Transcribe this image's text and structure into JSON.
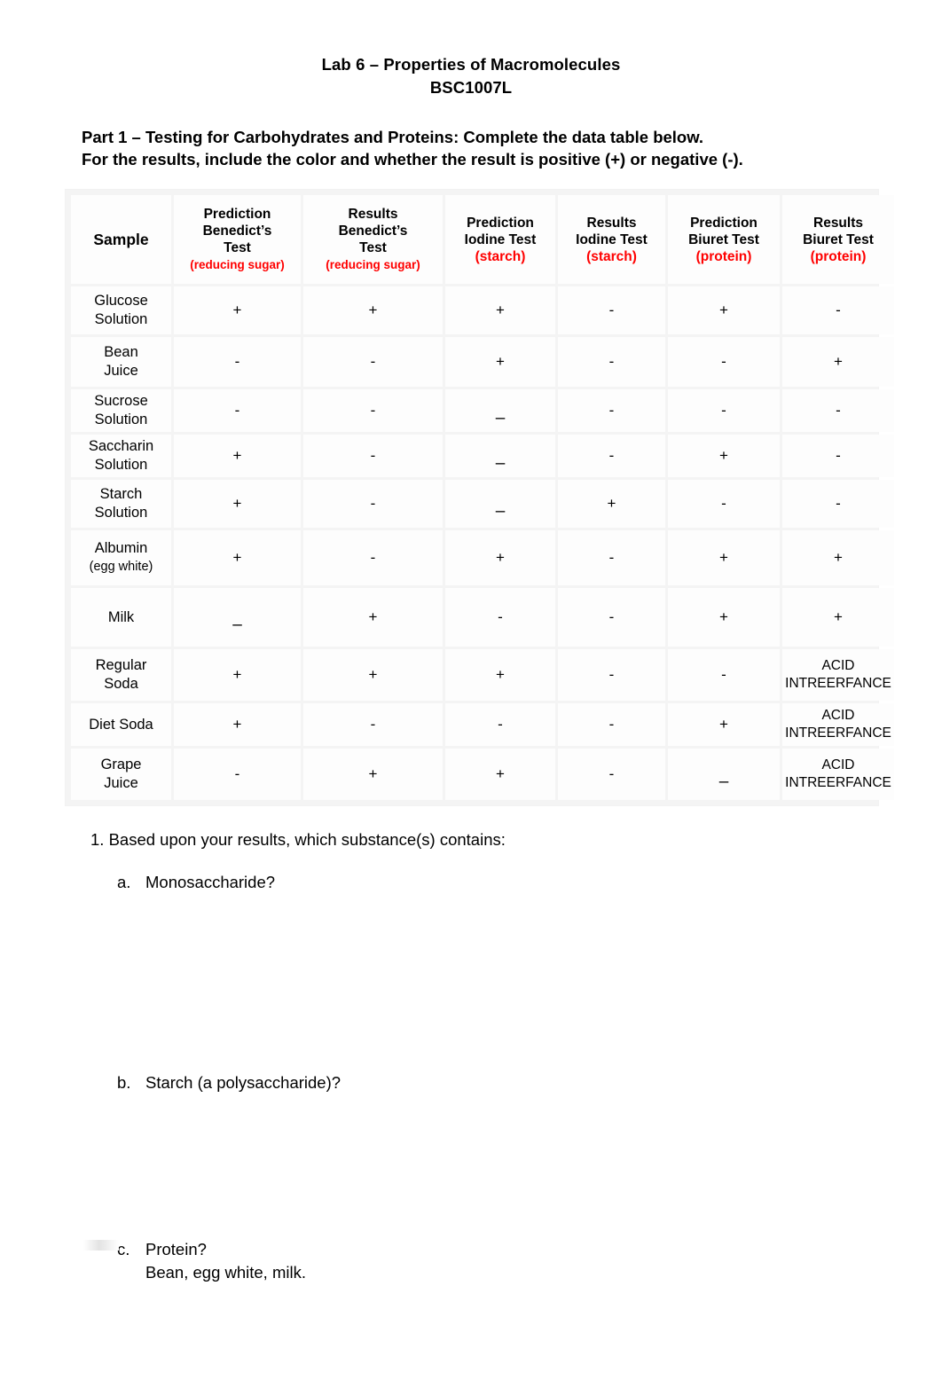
{
  "document": {
    "title": "Lab 6 – Properties of Macromolecules",
    "subtitle": "BSC1007L",
    "intro_line1": "Part 1 – Testing for Carbohydrates and Proteins: Complete the data table below.",
    "intro_line2": "For the results, include the color and whether the result is positive (+) or negative (-)."
  },
  "colors": {
    "red_accent": "#ff0000",
    "text": "#000000",
    "cell_background": "#fdfdfd",
    "table_gap": "#f4f4f4"
  },
  "table": {
    "headers": [
      {
        "main": "Sample",
        "red": ""
      },
      {
        "main": "Prediction Benedict’s Test",
        "red": "(reducing sugar)"
      },
      {
        "main": "Results Benedict’s Test",
        "red": "(reducing sugar)"
      },
      {
        "main": "Prediction Iodine Test",
        "red": "(starch)"
      },
      {
        "main": "Results Iodine Test",
        "red": "(starch)"
      },
      {
        "main": "Prediction Biuret Test",
        "red": "(protein)"
      },
      {
        "main": "Results Biuret Test",
        "red": "(protein)"
      }
    ],
    "header_lines": [
      {
        "lines": [
          "Sample"
        ],
        "red": ""
      },
      {
        "lines": [
          "Prediction",
          "Benedict’s",
          "Test"
        ],
        "red": "(reducing sugar)"
      },
      {
        "lines": [
          "Results",
          "Benedict’s",
          "Test"
        ],
        "red": "(reducing sugar)"
      },
      {
        "lines": [
          "Prediction",
          "Iodine Test"
        ],
        "red": "(starch)"
      },
      {
        "lines": [
          "Results",
          "Iodine Test"
        ],
        "red": "(starch)"
      },
      {
        "lines": [
          "Prediction",
          "Biuret Test"
        ],
        "red": "(protein)"
      },
      {
        "lines": [
          "Results",
          "Biuret Test"
        ],
        "red": "(protein)"
      }
    ],
    "rows": [
      {
        "sample": "Glucose Solution",
        "sample_lines": [
          "Glucose",
          "Solution"
        ],
        "sample_sub": "",
        "pred_benedict": "+",
        "res_benedict": "+",
        "pred_iodine": "+",
        "res_iodine": "-",
        "pred_biuret": "+",
        "res_biuret": "-"
      },
      {
        "sample": "Bean Juice",
        "sample_lines": [
          "Bean",
          "Juice"
        ],
        "sample_sub": "",
        "pred_benedict": "-",
        "res_benedict": "-",
        "pred_iodine": "+",
        "res_iodine": "-",
        "pred_biuret": "-",
        "res_biuret": "+"
      },
      {
        "sample": "Sucrose Solution",
        "sample_lines": [
          "Sucrose",
          "Solution"
        ],
        "sample_sub": "",
        "pred_benedict": "-",
        "res_benedict": "-",
        "pred_iodine": "–",
        "res_iodine": "-",
        "pred_biuret": "-",
        "res_biuret": "-"
      },
      {
        "sample": "Saccharin Solution",
        "sample_lines": [
          "Saccharin",
          "Solution"
        ],
        "sample_sub": "",
        "pred_benedict": "+",
        "res_benedict": "-",
        "pred_iodine": "–",
        "res_iodine": "-",
        "pred_biuret": "+",
        "res_biuret": "-"
      },
      {
        "sample": "Starch Solution",
        "sample_lines": [
          "Starch",
          "Solution"
        ],
        "sample_sub": "",
        "pred_benedict": "+",
        "res_benedict": "-",
        "pred_iodine": "–",
        "res_iodine": "+",
        "pred_biuret": "-",
        "res_biuret": "-"
      },
      {
        "sample": "Albumin (egg white)",
        "sample_lines": [
          "Albumin"
        ],
        "sample_sub": "(egg white)",
        "pred_benedict": "+",
        "res_benedict": "-",
        "pred_iodine": "+",
        "res_iodine": "-",
        "pred_biuret": "+",
        "res_biuret": "+"
      },
      {
        "sample": "Milk",
        "sample_lines": [
          "Milk"
        ],
        "sample_sub": "",
        "pred_benedict": "–",
        "res_benedict": "+",
        "pred_iodine": "-",
        "res_iodine": "-",
        "pred_biuret": "+",
        "res_biuret": "+"
      },
      {
        "sample": "Regular Soda",
        "sample_lines": [
          "Regular",
          "Soda"
        ],
        "sample_sub": "",
        "pred_benedict": "+",
        "res_benedict": "+",
        "pred_iodine": "+",
        "res_iodine": "-",
        "pred_biuret": "-",
        "res_biuret": "ACID INTREERFANCE"
      },
      {
        "sample": "Diet Soda",
        "sample_lines": [
          "Diet Soda"
        ],
        "sample_sub": "",
        "pred_benedict": "+",
        "res_benedict": "-",
        "pred_iodine": "-",
        "res_iodine": "-",
        "pred_biuret": "+",
        "res_biuret": "ACID INTREERFANCE"
      },
      {
        "sample": "Grape Juice",
        "sample_lines": [
          "Grape",
          "Juice"
        ],
        "sample_sub": "",
        "pred_benedict": "-",
        "res_benedict": "+",
        "pred_iodine": "+",
        "res_iodine": "-",
        "pred_biuret": "–",
        "res_biuret": "ACID INTREERFANCE"
      }
    ]
  },
  "questions": {
    "q1": "1. Based upon your results, which substance(s) contains:",
    "items": [
      {
        "letter": "a.",
        "text": "Monosaccharide?",
        "answer": ""
      },
      {
        "letter": "b.",
        "text": "Starch (a polysaccharide)?",
        "answer": ""
      },
      {
        "letter": "c.",
        "text": "Protein?",
        "answer": "Bean, egg white, milk."
      }
    ]
  }
}
